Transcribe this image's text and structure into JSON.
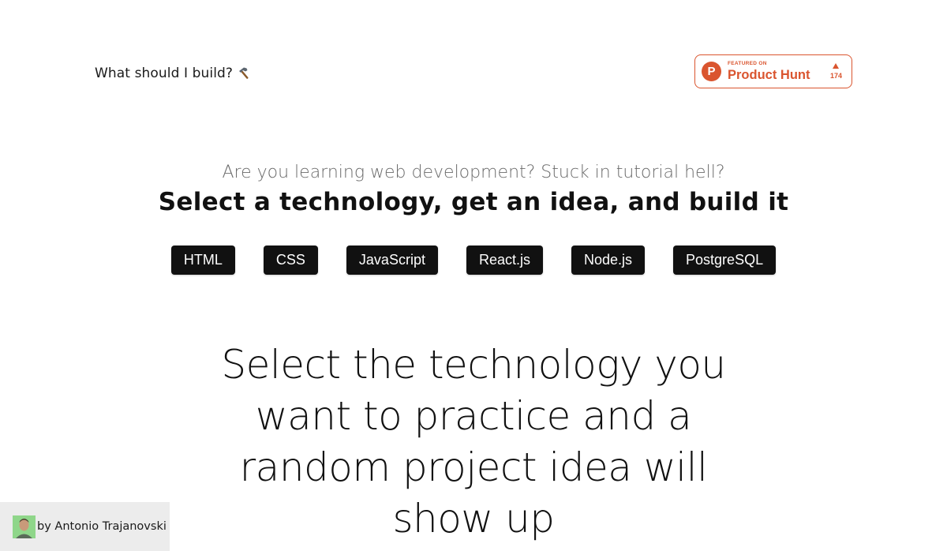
{
  "header": {
    "site_title": "What should I build?",
    "site_icon": "hammer-icon",
    "product_hunt": {
      "featured_label": "FEATURED ON",
      "name": "Product Hunt",
      "votes": "174",
      "accent": "#da552f"
    }
  },
  "hero": {
    "subtitle": "Are you learning web development? Stuck in tutorial hell?",
    "headline": "Select a technology, get an idea, and build it"
  },
  "technologies": [
    {
      "label": "HTML"
    },
    {
      "label": "CSS"
    },
    {
      "label": "JavaScript"
    },
    {
      "label": "React.js"
    },
    {
      "label": "Node.js"
    },
    {
      "label": "PostgreSQL"
    }
  ],
  "prompt": "Select the technology you want to practice and a random project idea will show up",
  "footer": {
    "author": "by Antonio Trajanovski",
    "avatar_color": "#8fd68a"
  }
}
